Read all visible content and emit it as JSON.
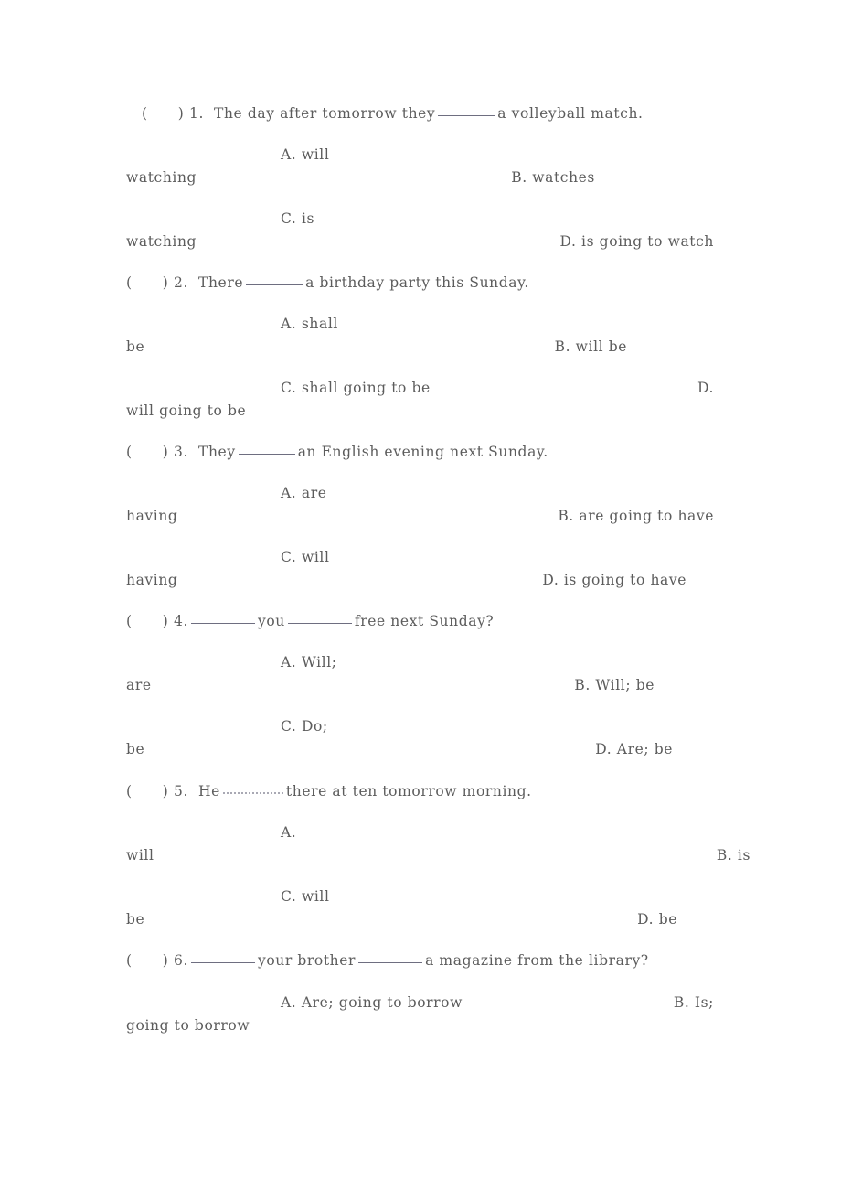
{
  "document": {
    "type": "grammar-exercise-worksheet",
    "language": "English",
    "topic": "Future tense: will / be going to",
    "text_color": "#5c5c5c",
    "page_background": "#ffffff",
    "blank_marker": "________"
  },
  "questions": [
    {
      "number": "1.",
      "bracket": "(      )",
      "stem_prefix": "The day after tomorrow they",
      "stem_suffix": "a volleyball match.",
      "blank_style": "solid",
      "options": [
        {
          "letter": "A.",
          "head": "will",
          "tail": "watching"
        },
        {
          "letter": "B.",
          "head": "watches",
          "tail": ""
        },
        {
          "letter": "C.",
          "head": "is",
          "tail": "watching"
        },
        {
          "letter": "D.",
          "head": "is going to watch",
          "tail": ""
        }
      ],
      "lines": [
        "(      ) 1.  The day after tomorrow they ________ a volleyball match.",
        "A. will",
        "watching",
        "B. watches",
        "C. is",
        "watching",
        "D. is going to watch"
      ]
    },
    {
      "number": "2.",
      "bracket": "(      )",
      "stem_prefix": "There",
      "stem_suffix": "a birthday party this Sunday.",
      "blank_style": "solid",
      "options": [
        {
          "letter": "A.",
          "head": "shall",
          "tail": "be"
        },
        {
          "letter": "B.",
          "head": "will be",
          "tail": ""
        },
        {
          "letter": "C.",
          "head": "shall going to be",
          "tail": ""
        },
        {
          "letter": "D.",
          "head": "",
          "tail": "will going to be"
        }
      ],
      "lines": [
        "(      ) 2.  There ________ a birthday party this Sunday.",
        "A. shall",
        "be",
        "B. will be",
        "C. shall going to be",
        "D.",
        "will going to be"
      ]
    },
    {
      "number": "3.",
      "bracket": "(      )",
      "stem_prefix": "They",
      "stem_suffix": "an English evening next Sunday.",
      "blank_style": "solid",
      "options": [
        {
          "letter": "A.",
          "head": "are",
          "tail": "having"
        },
        {
          "letter": "B.",
          "head": "are going to have",
          "tail": ""
        },
        {
          "letter": "C.",
          "head": "will",
          "tail": "having"
        },
        {
          "letter": "D.",
          "head": "is going to have",
          "tail": ""
        }
      ],
      "lines": [
        "(      ) 3.  They ________ an English evening next Sunday.",
        "A. are",
        "having",
        "B. are going to have",
        "C. will",
        "having",
        "D. is going to have"
      ]
    },
    {
      "number": "4.",
      "bracket": "(      )",
      "stem_prefix": "",
      "stem_middle": "you",
      "stem_suffix": "free next Sunday?",
      "blank_style": "solid",
      "options": [
        {
          "letter": "A.",
          "head": "Will;",
          "tail": "are"
        },
        {
          "letter": "B.",
          "head": "Will; be",
          "tail": ""
        },
        {
          "letter": "C.",
          "head": "Do;",
          "tail": "be"
        },
        {
          "letter": "D.",
          "head": "Are; be",
          "tail": ""
        }
      ],
      "lines": [
        "(      ) 4.  ________ you ________ free next Sunday?",
        "A. Will;",
        "are",
        "B. Will; be",
        "C. Do;",
        "be",
        "D. Are; be"
      ]
    },
    {
      "number": "5.",
      "bracket": "(      )",
      "stem_prefix": "He",
      "stem_suffix": "there at ten tomorrow morning.",
      "blank_style": "dotted",
      "options": [
        {
          "letter": "A.",
          "head": "",
          "tail": "will"
        },
        {
          "letter": "B.",
          "head": "is",
          "tail": ""
        },
        {
          "letter": "C.",
          "head": "will",
          "tail": "be"
        },
        {
          "letter": "D.",
          "head": "be",
          "tail": ""
        }
      ],
      "lines": [
        "(      ) 5.  He ________ there at ten tomorrow morning.",
        "A.",
        "will",
        "B. is",
        "C. will",
        "be",
        "D. be"
      ]
    },
    {
      "number": "6.",
      "bracket": "(      )",
      "stem_prefix": "",
      "stem_middle": "your brother",
      "stem_suffix": "a magazine from the library?",
      "blank_style": "solid",
      "options": [
        {
          "letter": "A.",
          "head": "Are; going to borrow",
          "tail": ""
        },
        {
          "letter": "B.",
          "head": "Is;",
          "tail": "going to borrow"
        }
      ],
      "lines": [
        "(      ) 6.  ________ your brother ________ a magazine from the library?",
        "A. Are; going to borrow",
        "B. Is;",
        "going to borrow"
      ]
    }
  ],
  "rendered_lines": {
    "q1_stem_a": "(      ) 1.  The day after tomorrow they",
    "q1_stem_b": "a volleyball match.",
    "q1_optA": "A. will",
    "q1_contA": "watching",
    "q1_optB": "B. watches",
    "q1_optC": "C. is",
    "q1_contC": "watching",
    "q1_optD": "D. is going to watch",
    "q2_stem_a": "(      ) 2.  There",
    "q2_stem_b": "a birthday party this Sunday.",
    "q2_optA": "A. shall",
    "q2_contA": "be",
    "q2_optB": "B. will be",
    "q2_optC": "C. shall going to be",
    "q2_optD": "D.",
    "q2_contD": "will going to be",
    "q3_stem_a": "(      ) 3.  They",
    "q3_stem_b": "an English evening next Sunday.",
    "q3_optA": "A. are",
    "q3_contA": "having",
    "q3_optB": "B. are going to have",
    "q3_optC": "C. will",
    "q3_contC": "having",
    "q3_optD": "D. is going to have",
    "q4_stem_a": "(      ) 4.",
    "q4_stem_b": "you",
    "q4_stem_c": "free next Sunday?",
    "q4_optA": "A. Will;",
    "q4_contA": "are",
    "q4_optB": "B. Will; be",
    "q4_optC": "C. Do;",
    "q4_contC": "be",
    "q4_optD": "D. Are; be",
    "q5_stem_a": "(      ) 5.  He",
    "q5_stem_b": "there at ten tomorrow morning.",
    "q5_optA": "A.",
    "q5_contA": "will",
    "q5_optB": "B. is",
    "q5_optC": "C. will",
    "q5_contC": "be",
    "q5_optD": "D. be",
    "q6_stem_a": "(      ) 6.",
    "q6_stem_b": "your brother",
    "q6_stem_c": "a magazine from the library?",
    "q6_optA": "A. Are; going to borrow",
    "q6_optB": "B. Is;",
    "q6_contB": "going to borrow"
  }
}
